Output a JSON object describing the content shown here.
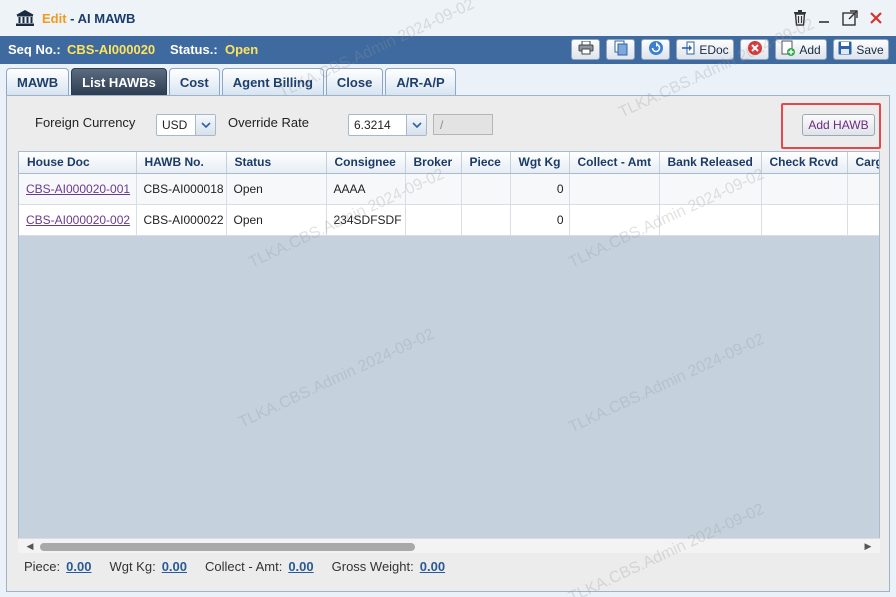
{
  "window": {
    "edit_label": "Edit",
    "title_rest": " - AI MAWB"
  },
  "infobar": {
    "seq_label": "Seq No.:",
    "seq_value": "CBS-AI000020",
    "status_label": "Status.:",
    "status_value": "Open"
  },
  "toolbar": {
    "edoc_label": "EDoc",
    "add_label": "Add",
    "save_label": "Save"
  },
  "tabs": [
    {
      "label": "MAWB"
    },
    {
      "label": "List HAWBs"
    },
    {
      "label": "Cost"
    },
    {
      "label": "Agent Billing"
    },
    {
      "label": "Close"
    },
    {
      "label": "A/R-A/P"
    }
  ],
  "active_tab": "List HAWBs",
  "filters": {
    "currency_label": "Foreign Currency",
    "currency_value": "USD",
    "rate_label": "Override Rate",
    "rate_value": "6.3214",
    "rate_extra": "/",
    "add_hawb_label": "Add HAWB"
  },
  "grid": {
    "columns": [
      "House Doc",
      "HAWB No.",
      "Status",
      "Consignee",
      "Broker",
      "Piece",
      "Wgt Kg",
      "Collect - Amt",
      "Bank Released",
      "Check Rcvd",
      "Cargo"
    ],
    "rows": [
      {
        "house_doc": "CBS-AI000020-001",
        "hawb_no": "CBS-AI000018",
        "status": "Open",
        "consignee": "AAAA",
        "broker": "",
        "piece": "",
        "wgt_kg": "0",
        "collect_amt": "",
        "bank_released": "",
        "check_rcvd": "",
        "cargo": ""
      },
      {
        "house_doc": "CBS-AI000020-002",
        "hawb_no": "CBS-AI000022",
        "status": "Open",
        "consignee": "234SDFSDF",
        "broker": "",
        "piece": "",
        "wgt_kg": "0",
        "collect_amt": "",
        "bank_released": "",
        "check_rcvd": "",
        "cargo": ""
      }
    ]
  },
  "footer": {
    "piece_label": "Piece:",
    "piece_value": "0.00",
    "wgt_label": "Wgt Kg:",
    "wgt_value": "0.00",
    "collect_label": "Collect - Amt:",
    "collect_value": "0.00",
    "gross_label": "Gross Weight:",
    "gross_value": "0.00"
  },
  "watermark": "TLKA.CBS.Admin 2024-09-02",
  "colors": {
    "infobar_bg": "#3e6aa0",
    "highlight_value": "#ffe35a",
    "edit_accent": "#f39a1d",
    "red_outline": "#e4474c"
  }
}
